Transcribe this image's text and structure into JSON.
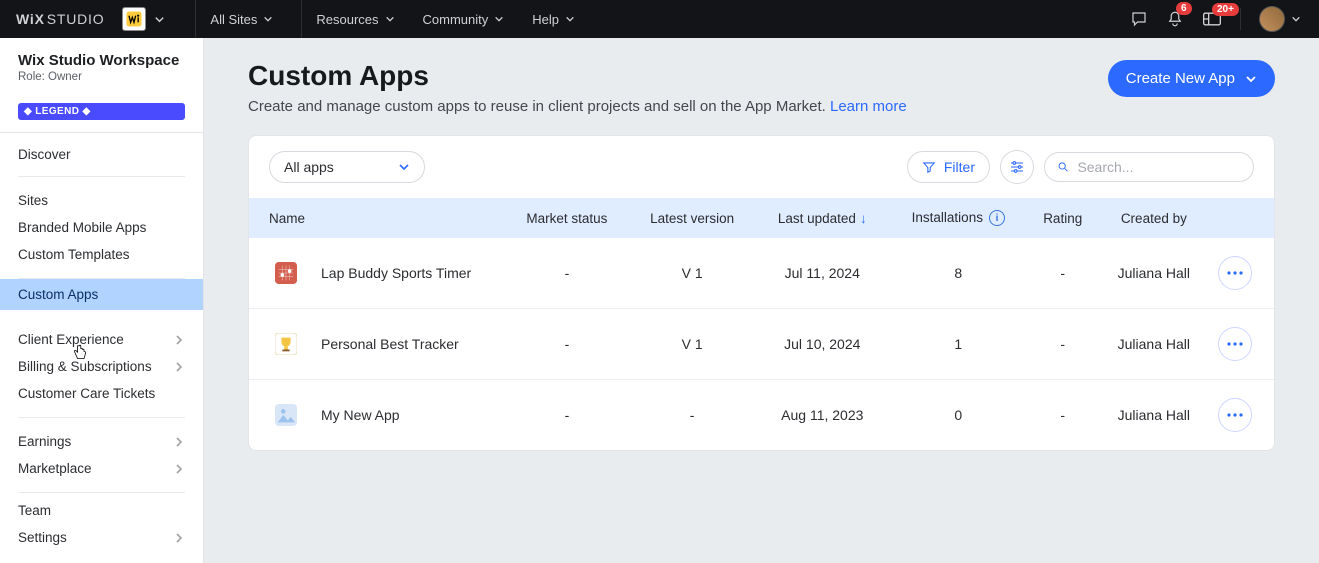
{
  "topbar": {
    "logo1": "WiX",
    "logo2": "STUDIO",
    "nav_all_sites": "All Sites",
    "nav_resources": "Resources",
    "nav_community": "Community",
    "nav_help": "Help",
    "bell_badge": "6",
    "inbox_badge": "20+"
  },
  "sidebar": {
    "workspace": "Wix Studio Workspace",
    "role": "Role: Owner",
    "legend": "◆ LEGEND ◆",
    "discover": "Discover",
    "sites": "Sites",
    "branded_mobile": "Branded Mobile Apps",
    "custom_templates": "Custom Templates",
    "custom_apps": "Custom Apps",
    "client_exp": "Client Experience",
    "billing": "Billing & Subscriptions",
    "care_tickets": "Customer Care Tickets",
    "earnings": "Earnings",
    "marketplace": "Marketplace",
    "team": "Team",
    "settings": "Settings"
  },
  "page": {
    "title": "Custom Apps",
    "subtitle": "Create and manage custom apps to reuse in client projects and sell on the App Market. ",
    "learn_more": "Learn more",
    "create_btn": "Create New App"
  },
  "toolbar": {
    "all_apps": "All apps",
    "filter": "Filter",
    "search_placeholder": "Search..."
  },
  "table": {
    "headers": {
      "name": "Name",
      "market": "Market status",
      "version": "Latest version",
      "updated": "Last updated",
      "installs": "Installations",
      "rating": "Rating",
      "created_by": "Created by"
    },
    "rows": [
      {
        "name": "Lap Buddy Sports Timer",
        "market": "-",
        "version": "V 1",
        "updated": "Jul 11, 2024",
        "installs": "8",
        "rating": "-",
        "created_by": "Juliana Hall",
        "icon_bg": "#d35e4e"
      },
      {
        "name": "Personal Best Tracker",
        "market": "-",
        "version": "V 1",
        "updated": "Jul 10, 2024",
        "installs": "1",
        "rating": "-",
        "created_by": "Juliana Hall",
        "icon_bg": "#f6f2e0"
      },
      {
        "name": "My New App",
        "market": "-",
        "version": "-",
        "updated": "Aug 11, 2023",
        "installs": "0",
        "rating": "-",
        "created_by": "Juliana Hall",
        "icon_bg": "#d8e6f7"
      }
    ]
  }
}
